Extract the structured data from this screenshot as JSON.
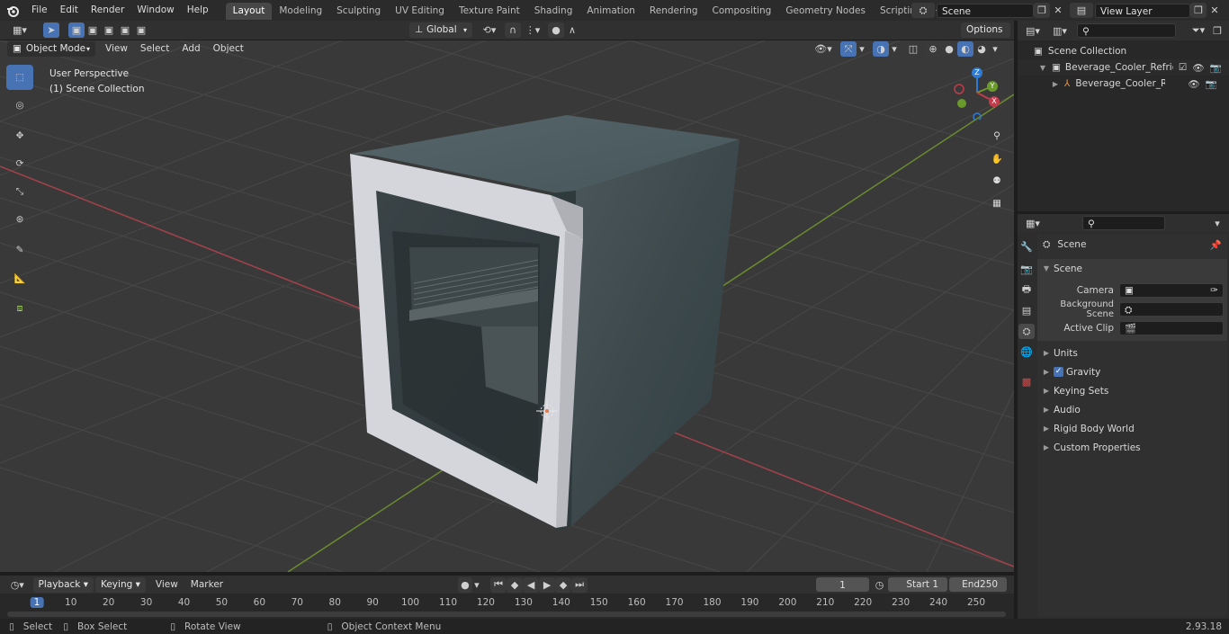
{
  "topbar": {
    "menus": [
      "File",
      "Edit",
      "Render",
      "Window",
      "Help"
    ],
    "workspaces": [
      "Layout",
      "Modeling",
      "Sculpting",
      "UV Editing",
      "Texture Paint",
      "Shading",
      "Animation",
      "Rendering",
      "Compositing",
      "Geometry Nodes",
      "Scripting"
    ],
    "active_workspace": "Layout",
    "scene_name": "Scene",
    "view_layer": "View Layer"
  },
  "viewport_header": {
    "mode": "Object Mode",
    "menus": [
      "View",
      "Select",
      "Add",
      "Object"
    ],
    "orientation": "Global",
    "options": "Options"
  },
  "viewport": {
    "perspective": "User Perspective",
    "collection": "(1) Scene Collection",
    "axes": {
      "x": "X",
      "y": "Y",
      "z": "Z"
    },
    "colors": {
      "x_axis": "#a5424b",
      "y_axis": "#6a8b2f",
      "active": "#4772b3"
    }
  },
  "outliner": {
    "root": "Scene Collection",
    "items": [
      "Beverage_Cooler_Refrigerato",
      "Beverage_Cooler_Refrig"
    ]
  },
  "properties": {
    "context": "Scene",
    "section": "Scene",
    "fields": [
      {
        "label": "Camera",
        "value": ""
      },
      {
        "label": "Background Scene",
        "value": ""
      },
      {
        "label": "Active Clip",
        "value": ""
      }
    ],
    "panels": [
      "Units",
      "Gravity",
      "Keying Sets",
      "Audio",
      "Rigid Body World",
      "Custom Properties"
    ]
  },
  "timeline": {
    "menus": [
      "Playback",
      "Keying",
      "View",
      "Marker"
    ],
    "current_frame": "1",
    "start_label": "Start",
    "start": "1",
    "end_label": "End",
    "end": "250",
    "ruler": [
      "1",
      "10",
      "20",
      "30",
      "40",
      "50",
      "60",
      "70",
      "80",
      "90",
      "100",
      "110",
      "120",
      "130",
      "140",
      "150",
      "160",
      "170",
      "180",
      "190",
      "200",
      "210",
      "220",
      "230",
      "240",
      "250"
    ]
  },
  "statusbar": {
    "select": "Select",
    "box_select": "Box Select",
    "rotate": "Rotate View",
    "context_menu": "Object Context Menu",
    "version": "2.93.18"
  }
}
